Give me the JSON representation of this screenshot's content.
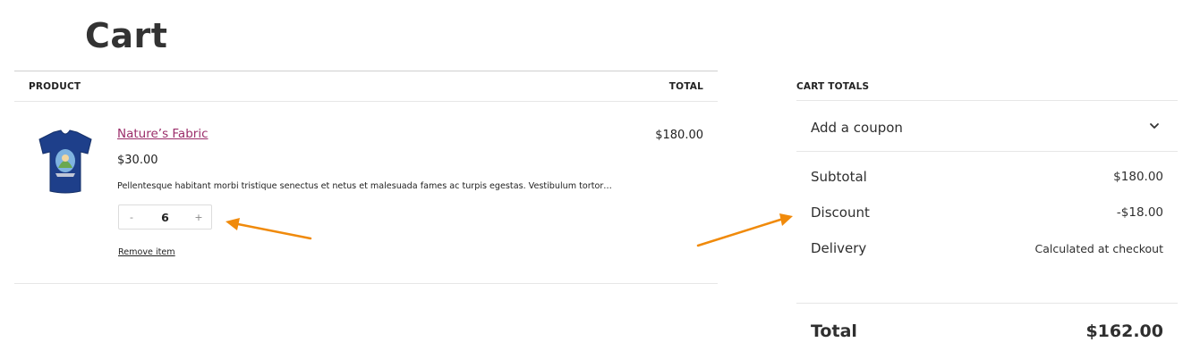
{
  "page": {
    "title": "Cart"
  },
  "cart": {
    "headers": {
      "product": "PRODUCT",
      "total": "TOTAL"
    },
    "items": [
      {
        "name": "Nature’s Fabric",
        "price": "$30.00",
        "description": "Pellentesque habitant morbi tristique senectus et netus et malesuada fames ac turpis egestas. Vestibulum tortor…",
        "quantity": "6",
        "decrement": "-",
        "increment": "+",
        "remove_label": "Remove item",
        "line_total": "$180.00"
      }
    ]
  },
  "totals": {
    "title": "CART TOTALS",
    "coupon_label": "Add a coupon",
    "subtotal_label": "Subtotal",
    "subtotal_value": "$180.00",
    "discount_label": "Discount",
    "discount_value": "-$18.00",
    "delivery_label": "Delivery",
    "delivery_value": "Calculated at checkout",
    "total_label": "Total",
    "total_value": "$162.00"
  },
  "colors": {
    "product_link": "#9b2d6a",
    "annotation_arrow": "#f08a0b",
    "shirt": "#1e3f8a"
  },
  "icons": {
    "coupon_toggle": "chevron-down-icon",
    "product_image": "tshirt-image"
  }
}
